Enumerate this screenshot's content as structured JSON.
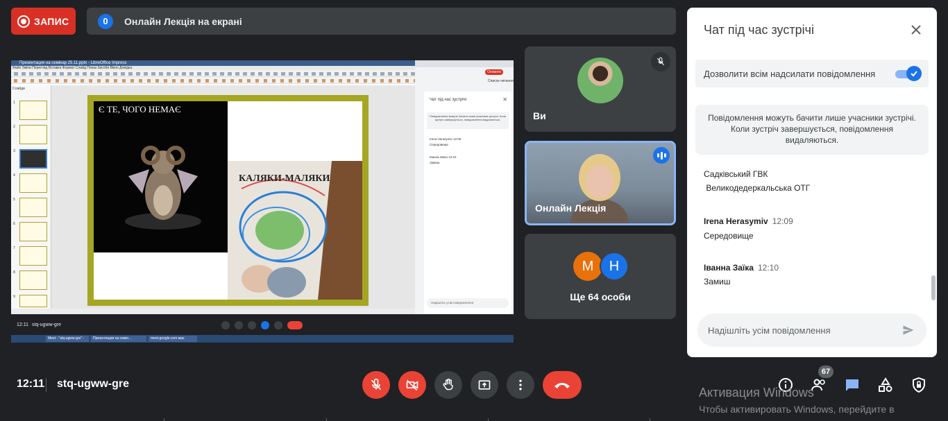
{
  "topbar": {
    "record_label": "ЗАПИС",
    "presenter_count": "0",
    "presenter_title": "Онлайн Лекція на екрані"
  },
  "shared_screen": {
    "window_title": "Презентация на семінар 25.11.pptx - LibreOffice Impress",
    "menu": "Файл Зміни Перегляд Вставка Формат Слайд Показ Засоби Вікно Довідка",
    "slides_label": "Слайди",
    "thumb_numbers": [
      "1",
      "2",
      "3",
      "4",
      "5",
      "6",
      "7",
      "8",
      "9"
    ],
    "slide_title_left": "Є ТЕ, ЧОГО НЕМАЄ",
    "slide_title_right": "КАЛЯКИ-МАЛЯКИ",
    "browser_btn": "Оновити",
    "browser_list": "Список читання",
    "mini_chat": {
      "title": "Чат під час зустрічі",
      "note": "Повідомлення можуть бачити лише учасники зустрічі. Коли зустріч завершується, повідомлення видаляються.",
      "msg1_author": "Irena Herasymiv  12:09",
      "msg1_text": "Середовище",
      "msg2_author": "Іванна Заїка  12:10",
      "msg2_text": "Замиш",
      "input_placeholder": "Надішліть усім повідомлення"
    },
    "mini_meet_time": "12:11",
    "mini_meet_code": "stq-ugww-gre",
    "taskbar_items": [
      "Meet - \"stq-ugww-gre\" -",
      "Презентация на семін...",
      "meet.google.com має"
    ]
  },
  "tiles": {
    "me_name": "Ви",
    "speaker_name": "Онлайн Лекція",
    "more_label": "Ще 64 особи",
    "avatar_m": "M",
    "avatar_h": "H"
  },
  "chat": {
    "title": "Чат під час зустрічі",
    "allow_label": "Дозволити всім надсилати повідомлення",
    "info": "Повідомлення можуть бачити лише учасники зустрічі. Коли зустріч завершується, повідомлення видаляються.",
    "line1": "Садківський ГВК",
    "line2": " Великодедеркальська ОТГ",
    "msg1_author": "Irena Herasymiv",
    "msg1_time": "12:09",
    "msg1_text": "Середовище",
    "msg2_author": "Іванна Заїка",
    "msg2_time": "12:10",
    "msg2_text": "Замиш",
    "input_placeholder": "Надішліть усім повідомлення"
  },
  "bottombar": {
    "time": "12:11",
    "meeting_code": "stq-ugww-gre",
    "people_badge": "67"
  },
  "watermark": {
    "line1": "Активация Windows",
    "line2": "Чтобы активировать Windows, перейдите в"
  },
  "colors": {
    "accent": "#1a73e8",
    "danger": "#ea4335",
    "surface": "#3c4043",
    "background": "#202124"
  }
}
